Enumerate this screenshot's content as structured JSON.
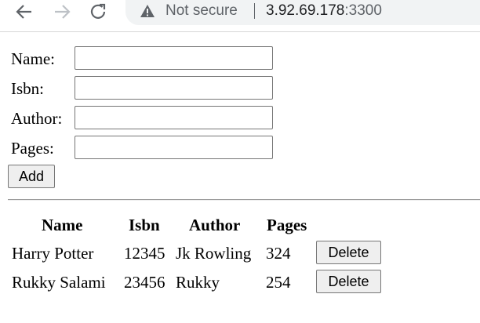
{
  "browser": {
    "security_label": "Not secure",
    "url_host": "3.92.69.178",
    "url_port": ":3300"
  },
  "form": {
    "fields": [
      {
        "label": "Name:",
        "value": ""
      },
      {
        "label": "Isbn:",
        "value": ""
      },
      {
        "label": "Author:",
        "value": ""
      },
      {
        "label": "Pages:",
        "value": ""
      }
    ],
    "add_label": "Add"
  },
  "table": {
    "headers": [
      "Name",
      "Isbn",
      "Author",
      "Pages"
    ],
    "rows": [
      {
        "name": "Harry Potter",
        "isbn": "12345",
        "author": "Jk Rowling",
        "pages": "324",
        "action": "Delete"
      },
      {
        "name": "Rukky Salami",
        "isbn": "23456",
        "author": "Rukky",
        "pages": "254",
        "action": "Delete"
      }
    ]
  }
}
